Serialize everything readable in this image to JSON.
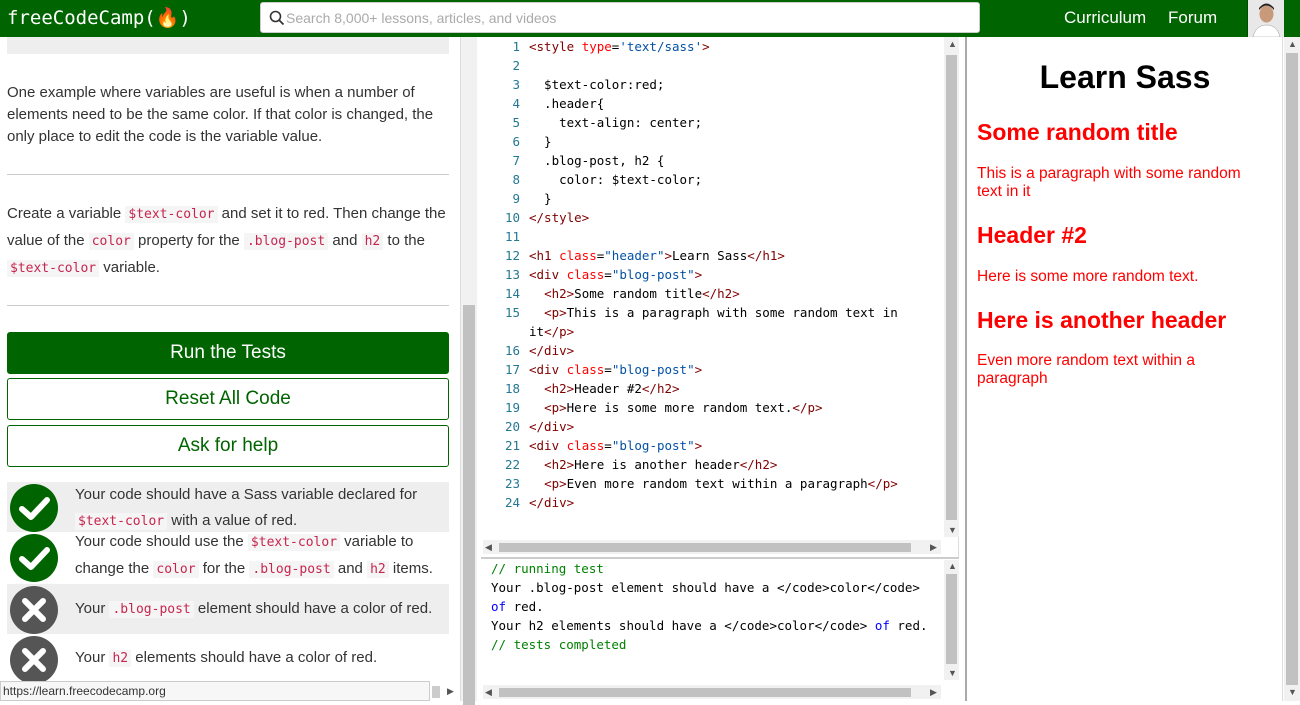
{
  "header": {
    "brand": "freeCodeCamp(🔥)",
    "search_placeholder": "Search 8,000+ lessons, articles, and videos",
    "nav": [
      "Curriculum",
      "Forum"
    ]
  },
  "lesson": {
    "paragraph1": "One example where variables are useful is when a number of elements need to be the same color. If that color is changed, the only place to edit the code is the variable value.",
    "instr": {
      "t1": "Create a variable ",
      "c1": "$text-color",
      "t2": " and set it to red. Then change the value of the ",
      "c2": "color",
      "t3": " property for the ",
      "c3": ".blog-post",
      "t4": " and ",
      "c4": "h2",
      "t5": " to the ",
      "c5": "$text-color",
      "t6": " variable."
    },
    "buttons": {
      "run": "Run the Tests",
      "reset": "Reset All Code",
      "help": "Ask for help"
    }
  },
  "tests": [
    {
      "status": "pass",
      "parts": [
        "Your code should have a Sass variable declared for ",
        "$text-color",
        " with a value of red."
      ]
    },
    {
      "status": "pass",
      "parts": [
        "Your code should use the ",
        "$text-color",
        " variable to change the ",
        "color",
        " for the ",
        ".blog-post",
        " and ",
        "h2",
        " items."
      ]
    },
    {
      "status": "fail",
      "parts": [
        "Your ",
        ".blog-post",
        " element should have a color of red."
      ]
    },
    {
      "status": "fail",
      "parts": [
        "Your ",
        "h2",
        " elements should have a color of red."
      ]
    }
  ],
  "status_url": "https://learn.freecodecamp.org",
  "editor": {
    "lines": [
      {
        "n": "1",
        "html": "<span class='tg'>&lt;style</span> <span class='at'>type</span>=<span class='sv'>'text/sass'</span><span class='tg'>&gt;</span>"
      },
      {
        "n": "2",
        "html": ""
      },
      {
        "n": "3",
        "html": "  $text-color:red;"
      },
      {
        "n": "4",
        "html": "  .header{"
      },
      {
        "n": "5",
        "html": "    text-align: center;"
      },
      {
        "n": "6",
        "html": "  }"
      },
      {
        "n": "7",
        "html": "  .blog-post, h2 {"
      },
      {
        "n": "8",
        "html": "    color: $text-color;"
      },
      {
        "n": "9",
        "html": "  }"
      },
      {
        "n": "10",
        "html": "<span class='tg'>&lt;/style&gt;</span>"
      },
      {
        "n": "11",
        "html": ""
      },
      {
        "n": "12",
        "html": "<span class='tg'>&lt;h1</span> <span class='at'>class</span>=<span class='sv'>\"header\"</span><span class='tg'>&gt;</span>Learn Sass<span class='tg'>&lt;/h1&gt;</span>"
      },
      {
        "n": "13",
        "html": "<span class='tg'>&lt;div</span> <span class='at'>class</span>=<span class='sv'>\"blog-post\"</span><span class='tg'>&gt;</span>"
      },
      {
        "n": "14",
        "html": "  <span class='tg'>&lt;h2&gt;</span>Some random title<span class='tg'>&lt;/h2&gt;</span>"
      },
      {
        "n": "15",
        "html": "  <span class='tg'>&lt;p&gt;</span>This is a paragraph with some random text in"
      },
      {
        "n": "",
        "html": "it<span class='tg'>&lt;/p&gt;</span>"
      },
      {
        "n": "16",
        "html": "<span class='tg'>&lt;/div&gt;</span>"
      },
      {
        "n": "17",
        "html": "<span class='tg'>&lt;div</span> <span class='at'>class</span>=<span class='sv'>\"blog-post\"</span><span class='tg'>&gt;</span>"
      },
      {
        "n": "18",
        "html": "  <span class='tg'>&lt;h2&gt;</span>Header #2<span class='tg'>&lt;/h2&gt;</span>"
      },
      {
        "n": "19",
        "html": "  <span class='tg'>&lt;p&gt;</span>Here is some more random text.<span class='tg'>&lt;/p&gt;</span>"
      },
      {
        "n": "20",
        "html": "<span class='tg'>&lt;/div&gt;</span>"
      },
      {
        "n": "21",
        "html": "<span class='tg'>&lt;div</span> <span class='at'>class</span>=<span class='sv'>\"blog-post\"</span><span class='tg'>&gt;</span>"
      },
      {
        "n": "22",
        "html": "  <span class='tg'>&lt;h2&gt;</span>Here is another header<span class='tg'>&lt;/h2&gt;</span>"
      },
      {
        "n": "23",
        "html": "  <span class='tg'>&lt;p&gt;</span>Even more random text within a paragraph<span class='tg'>&lt;/p&gt;</span>"
      },
      {
        "n": "24",
        "html": "<span class='tg'>&lt;/div&gt;</span>"
      }
    ]
  },
  "console": {
    "lines": [
      "<span class='cm'>// running test</span>",
      "Your .blog-post element should have a &lt;/code&gt;color&lt;/code&gt;",
      "<span class='kw'>of</span> red.",
      "Your h2 elements should have a &lt;/code&gt;color&lt;/code&gt; <span class='kw'>of</span> red.",
      "<span class='cm'>// tests completed</span>"
    ]
  },
  "preview": {
    "h1": "Learn Sass",
    "posts": [
      {
        "h2": "Some random title",
        "p": "This is a paragraph with some random text in it"
      },
      {
        "h2": "Header #2",
        "p": "Here is some more random text."
      },
      {
        "h2": "Here is another header",
        "p": "Even more random text within a paragraph"
      }
    ]
  },
  "colors": {
    "brand": "#006400",
    "preview_red": "#ff0000"
  }
}
